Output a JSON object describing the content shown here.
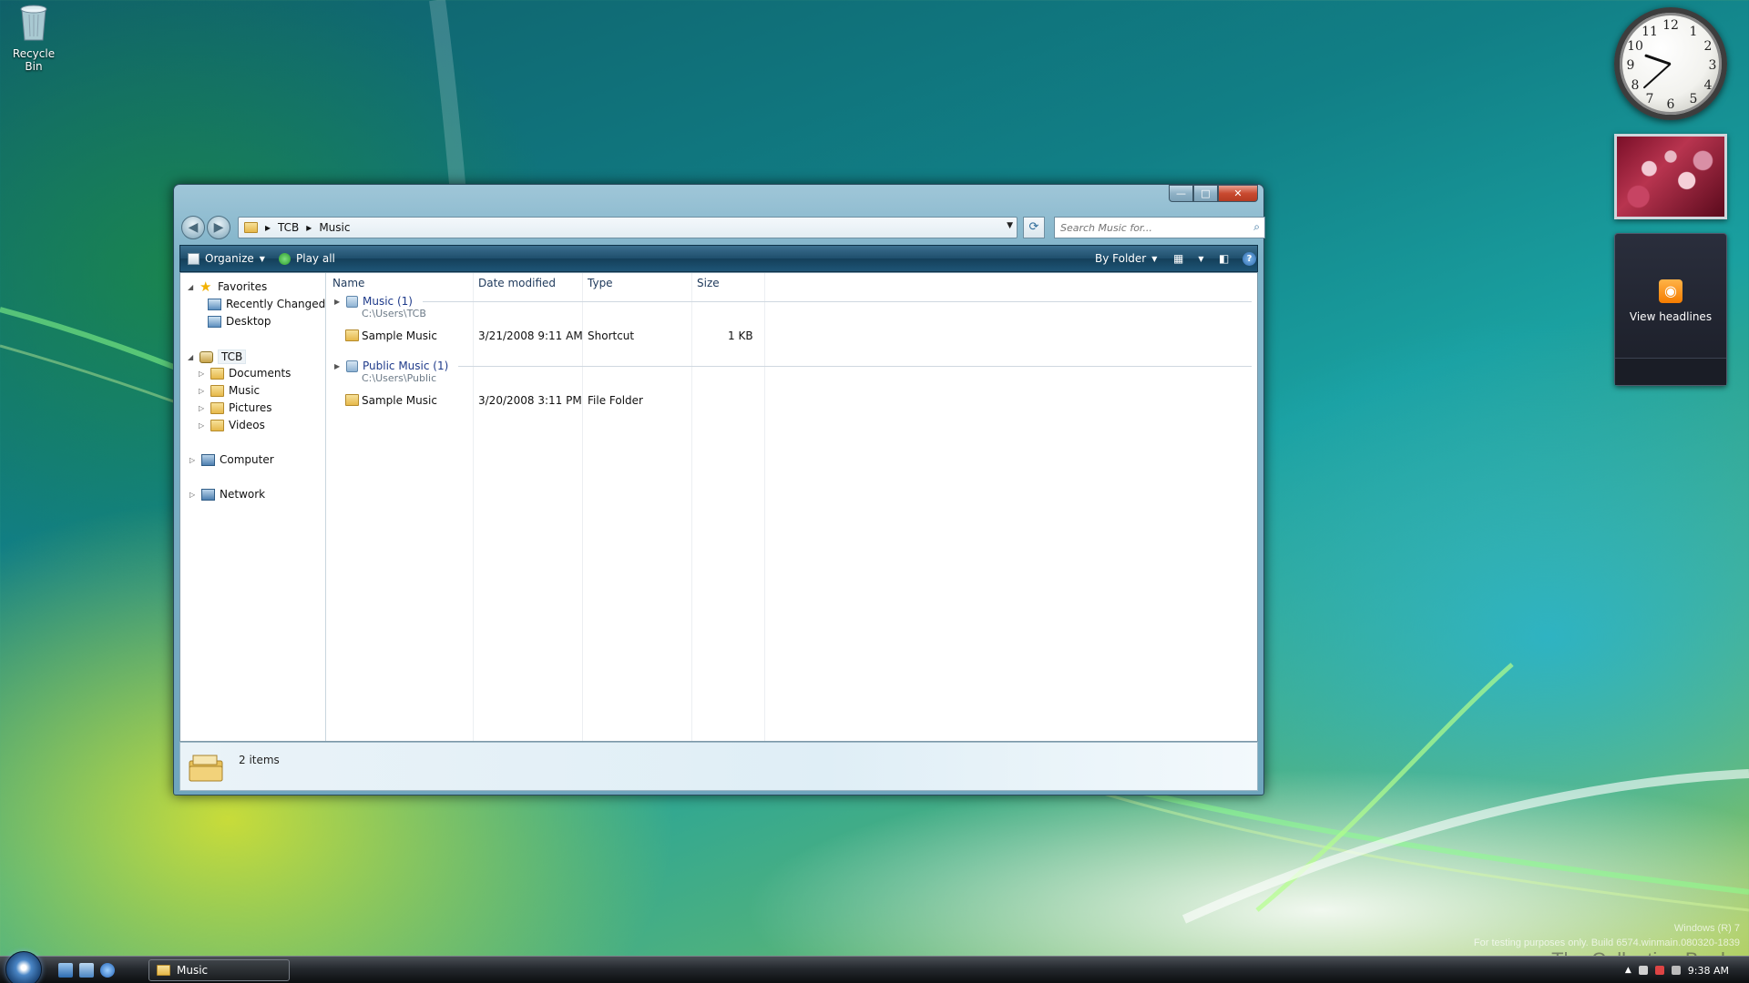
{
  "desktop": {
    "recycle_bin_label": "Recycle Bin",
    "watermark_line1": "Windows (R) 7",
    "watermark_line2": "For testing purposes only. Build 6574.winmain.080320-1839",
    "collection_book": "The Collection Book"
  },
  "gadgets": {
    "clock": {
      "numbers": [
        "12",
        "1",
        "2",
        "3",
        "4",
        "5",
        "6",
        "7",
        "8",
        "9",
        "10",
        "11"
      ],
      "time_hour": 9,
      "time_minute": 38
    },
    "feed_label": "View headlines",
    "feed_icon": "rss-icon"
  },
  "window": {
    "controls": {
      "minimize": "—",
      "maximize": "□",
      "close": "✕"
    },
    "address": {
      "crumbs": [
        "TCB",
        "Music"
      ],
      "sep": "▸"
    },
    "search_placeholder": "Search Music for...",
    "toolbar": {
      "organize": "Organize",
      "play_all": "Play all",
      "by_folder": "By Folder"
    },
    "nav_tree": {
      "favorites": "Favorites",
      "recently_changed": "Recently Changed",
      "desktop": "Desktop",
      "tcb": "TCB",
      "documents": "Documents",
      "music": "Music",
      "pictures": "Pictures",
      "videos": "Videos",
      "computer": "Computer",
      "network": "Network"
    },
    "columns": [
      "Name",
      "Date modified",
      "Type",
      "Size"
    ],
    "groups": [
      {
        "title": "Music (1)",
        "path": "C:\\Users\\TCB",
        "rows": [
          {
            "name": "Sample Music",
            "date": "3/21/2008 9:11 AM",
            "type": "Shortcut",
            "size": "1 KB"
          }
        ]
      },
      {
        "title": "Public Music (1)",
        "path": "C:\\Users\\Public",
        "rows": [
          {
            "name": "Sample Music",
            "date": "3/20/2008 3:11 PM",
            "type": "File Folder",
            "size": ""
          }
        ]
      }
    ],
    "details_pane": {
      "count": "2 items"
    }
  },
  "taskbar": {
    "active_window": "Music",
    "clock": "9:38 AM"
  }
}
